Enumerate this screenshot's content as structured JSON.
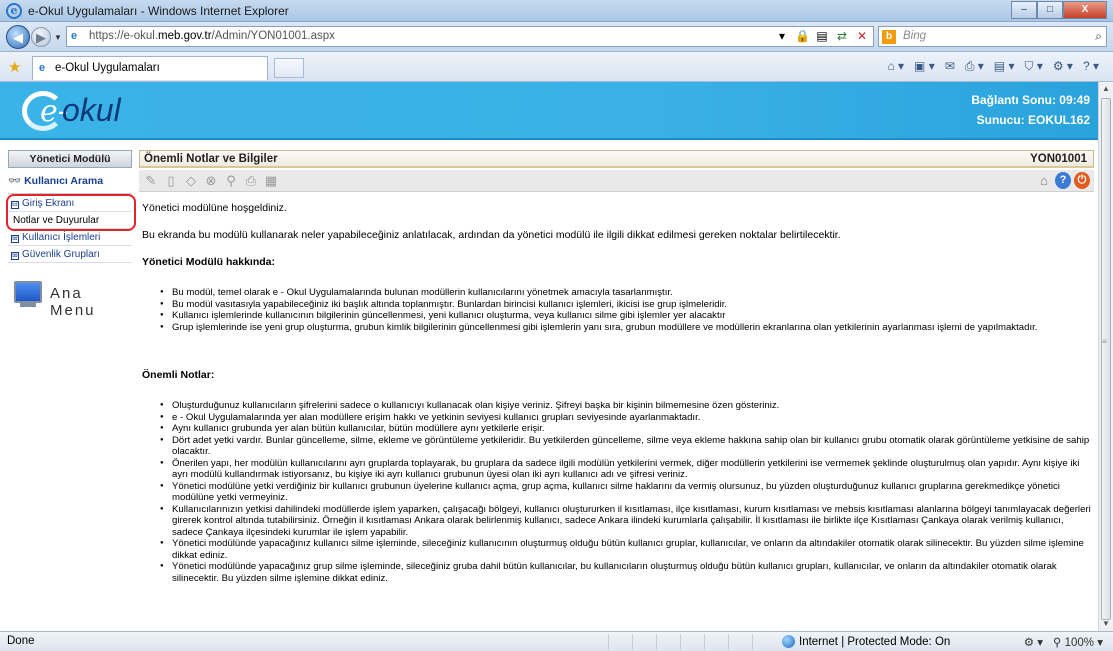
{
  "window": {
    "title": "e-Okul Uygulamaları - Windows Internet Explorer",
    "minimize": "–",
    "maximize": "□",
    "close": "X"
  },
  "addressbar": {
    "url_prefix": "https://e-okul.",
    "url_domain": "meb.gov.tr",
    "url_path": "/Admin/YON01001.aspx",
    "search_placeholder": "Bing"
  },
  "tabs": [
    {
      "label": "e-Okul Uygulamaları"
    }
  ],
  "header": {
    "logo_text": "okul",
    "logo_e": "e-",
    "connection": "Bağlantı Sonu: 09:49",
    "server": "Sunucu: EOKUL162"
  },
  "sidebar": {
    "title": "Yönetici Modülü",
    "search": "Kullanıcı Arama",
    "items": [
      {
        "label": "Giriş Ekranı",
        "type": "group"
      },
      {
        "label": "Notlar ve Duyurular",
        "type": "sub"
      },
      {
        "label": "Kullanıcı İşlemleri",
        "type": "group"
      },
      {
        "label": "Güvenlik Grupları",
        "type": "group"
      }
    ],
    "main_menu": "Ana Menu"
  },
  "main": {
    "title": "Önemli Notlar ve Bilgiler",
    "code": "YON01001",
    "welcome": "Yönetici modülüne hoşgeldiniz.",
    "intro": "Bu ekranda bu modülü kullanarak neler yapabileceğiniz anlatılacak, ardından da yönetici modülü ile ilgili dikkat edilmesi gereken noktalar belirtilecektir.",
    "about_heading": "Yönetici Modülü hakkında:",
    "about_items": [
      "Bu modül, temel olarak e - Okul Uygulamalarında bulunan modüllerin kullanıcılarını yönetmek amacıyla tasarlanmıştır.",
      "Bu modül vasıtasıyla yapabileceğiniz iki başlık altında toplanmıştır. Bunlardan birincisi kullanıcı işlemleri, ikicisi ise grup işlmeleridir.",
      "Kullanıcı işlemlerinde kullanıcının bilgilerinin güncellenmesi, yeni kullanıcı oluşturma, veya kullanıcı silme gibi işlemler yer alacaktır",
      "Grup işlemlerinde ise yeni grup oluşturma, grubun kimlik bilgilerinin güncellenmesi gibi işlemlerin yanı sıra, grubun modüllere ve modüllerin ekranlarına olan yetkilerinin ayarlanması işlemi de yapılmaktadır."
    ],
    "notes_heading": "Önemli Notlar:",
    "notes_items": [
      "Oluşturduğunuz kullanıcıların şifrelerini sadece o kullanıcıyı kullanacak olan kişiye veriniz. Şifreyi başka bir kişinin bilmemesine özen gösteriniz.",
      "e - Okul Uygulamalarında yer alan modüllere erişim hakkı ve yetkinin seviyesi kullanıcı grupları seviyesinde ayarlanmaktadır.",
      "Aynı kullanıcı grubunda yer alan bütün kullanıcılar, bütün modüllere aynı yetkilerle erişir.",
      "Dört adet yetki vardır. Bunlar güncelleme, silme, ekleme ve görüntüleme yetkileridir. Bu yetkilerden güncelleme, silme veya ekleme hakkına sahip olan bir kullanıcı grubu otomatik olarak görüntüleme yetkisine de sahip olacaktır.",
      "Önerilen yapı, her modülün kullanıcılarını ayrı gruplarda toplayarak, bu gruplara da sadece ilgili modülün yetkilerini vermek, diğer modüllerin yetkilerini ise vermemek şeklinde oluşturulmuş olan yapıdır. Aynı kişiye iki ayrı modülü kullandırmak istiyorsanız, bu kişiye iki ayrı kullanıcı grubunun üyesi olan iki ayrı kullanıcı adı ve şifresi veriniz.",
      "Yönetici modülüne yetki verdiğiniz bir kullanıcı grubunun üyelerine kullanıcı açma, grup açma, kullanıcı silme haklarını da vermiş olursunuz, bu yüzden oluşturduğunuz kullanıcı gruplarına gerekmedikçe yönetici modülüne yetki vermeyiniz.",
      "Kullanıcılarınızın yetkisi dahilindeki modüllerde işlem yaparken, çalışacağı bölgeyi, kullanıcı oluştururken il kısıtlaması, ilçe kısıtlaması, kurum kısıtlaması ve mebsis kısıtlaması alanlarına bölgeyi tanımlayacak değerleri girerek kontrol altında tutabilirsiniz. Örneğin il kısıtlaması Ankara olarak belirlenmiş kullanıcı, sadece Ankara ilindeki kurumlarla çalışabilir. İl kısıtlaması ile birlikte ilçe Kısıtlaması Çankaya olarak verilmiş kullanıcı, sadece Çankaya ilçesindeki kurumlar ile işlem yapabilir.",
      "Yönetici modülünde yapacağınız kullanıcı silme işleminde, sileceğiniz kullanıcının oluşturmuş olduğu bütün kullanıcı gruplar, kullanıcılar, ve onların da altındakiler otomatik olarak silinecektir. Bu yüzden silme işlemine dikkat ediniz.",
      "Yönetici modülünde yapacağınız grup silme işleminde, sileceğiniz gruba dahil bütün kullanıcılar, bu kullanıcıların oluşturmuş olduğu bütün kullanıcı grupları, kullanıcılar, ve onların da altındakiler otomatik olarak silinecektir. Bu yüzden silme işlemine dikkat ediniz."
    ]
  },
  "status": {
    "text": "Done",
    "zone": "Internet | Protected Mode: On",
    "zoom": "100%"
  },
  "colors": {
    "header_bg": "#39b1e6",
    "logo_text": "#0e3a78",
    "sidebar_link": "#1b3f8c",
    "highlight": "#e0242a"
  }
}
